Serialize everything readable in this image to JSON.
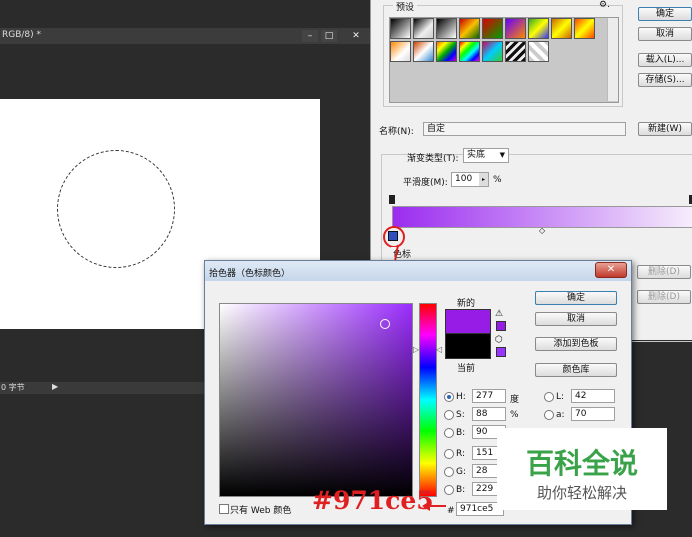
{
  "editor": {
    "doc_tab_title": "RGB/8) *",
    "minimize": "–",
    "restore": "□",
    "close": "✕",
    "status_text": "0 字节",
    "status_arrow": "▶"
  },
  "gradient_editor": {
    "presets_label": "预设",
    "gear": "⚙.",
    "buttons": {
      "ok": "确定",
      "cancel": "取消",
      "load": "载入(L)...",
      "save": "存储(S)...",
      "new": "新建(W)",
      "delete1": "删除(D)",
      "delete2": "删除(D)"
    },
    "name_label": "名称(N):",
    "name_value": "自定",
    "gradient_type_label": "渐变类型(T):",
    "gradient_type_value": "实底",
    "smoothness_label": "平滑度(M):",
    "smoothness_value": "100",
    "percent": "%",
    "stops_label": "色标",
    "gradient_start": "#9b2cf0",
    "gradient_end": "#f7eefc"
  },
  "picker": {
    "title": "拾色器（色标颜色）",
    "new_label": "新的",
    "current_label": "当前",
    "new_color": "#971ce5",
    "current_color": "#000000",
    "buttons": {
      "ok": "确定",
      "cancel": "取消",
      "add_swatch": "添加到色板",
      "libraries": "颜色库"
    },
    "fields": {
      "h_label": "H:",
      "h_value": "277",
      "h_unit": "度",
      "s_label": "S:",
      "s_value": "88",
      "s_unit": "%",
      "b_label": "B:",
      "b_value": "90",
      "r_label": "R:",
      "r_value": "151",
      "g_label": "G:",
      "g_value": "28",
      "bb_label": "B:",
      "bb_value": "229",
      "l_label": "L:",
      "l_value": "42",
      "a_label": "a:",
      "a_value": "70",
      "hex_label": "#",
      "hex_value": "971ce5"
    },
    "web_only_label": "只有 Web 颜色"
  },
  "annotation": "#971ce5",
  "watermark": {
    "main": "百科全说",
    "sub": "助你轻松解决"
  }
}
